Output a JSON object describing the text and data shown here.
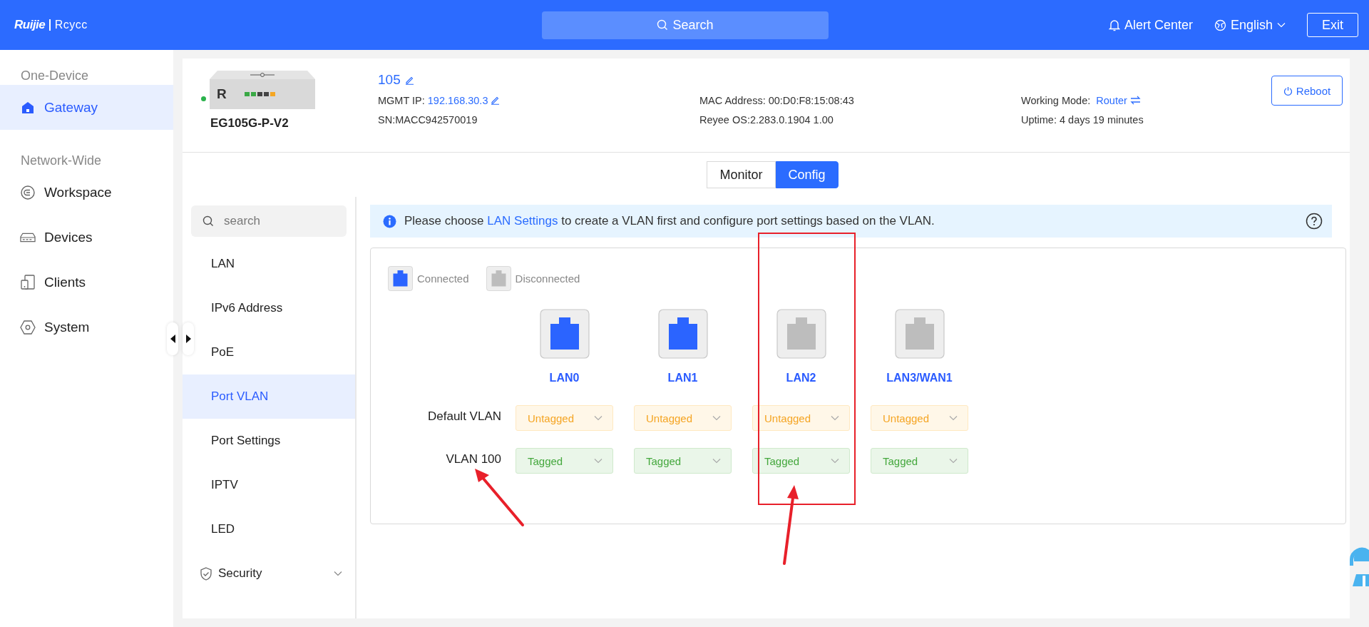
{
  "topbar": {
    "logo_brand": "Ruijie",
    "logo_product": "Rcycc",
    "search": "Search",
    "alert_center": "Alert Center",
    "language": "English",
    "exit": "Exit"
  },
  "sidebar": {
    "sections": [
      {
        "title": "One-Device",
        "items": [
          {
            "label": "Gateway",
            "selected": true
          }
        ]
      },
      {
        "title": "Network-Wide",
        "items": [
          {
            "label": "Workspace",
            "selected": false
          },
          {
            "label": "Devices",
            "selected": false
          },
          {
            "label": "Clients",
            "selected": false
          },
          {
            "label": "System",
            "selected": false
          }
        ]
      }
    ]
  },
  "device": {
    "online": true,
    "image_label": "R",
    "model": "EG105G-P-V2",
    "alias": "105",
    "mgmt_ip_label": "MGMT IP:",
    "mgmt_ip": "192.168.30.3",
    "sn": "SN:MACC942570019",
    "mac": "MAC Address: 00:D0:F8:15:08:43",
    "os": "Reyee OS:2.283.0.1904 1.00",
    "working_mode_label": "Working Mode:",
    "working_mode": "Router",
    "uptime": "Uptime: 4 days 19 minutes",
    "reboot": "Reboot"
  },
  "mode_tabs": [
    {
      "label": "Monitor",
      "selected": false
    },
    {
      "label": "Config",
      "selected": true
    }
  ],
  "config_menu": {
    "placeholder": "search",
    "items": [
      {
        "label": "LAN",
        "selected": false,
        "kind": "item"
      },
      {
        "label": "IPv6 Address",
        "selected": false,
        "kind": "item"
      },
      {
        "label": "PoE",
        "selected": false,
        "kind": "item"
      },
      {
        "label": "Port VLAN",
        "selected": true,
        "kind": "item"
      },
      {
        "label": "Port Settings",
        "selected": false,
        "kind": "item"
      },
      {
        "label": "IPTV",
        "selected": false,
        "kind": "item"
      },
      {
        "label": "LED",
        "selected": false,
        "kind": "item"
      },
      {
        "label": "Security",
        "selected": false,
        "kind": "group",
        "expanded": false
      }
    ]
  },
  "notice": {
    "before": "Please choose ",
    "link": "LAN Settings",
    "after": " to create a VLAN first and configure port settings based on the VLAN."
  },
  "legend": [
    {
      "label": "Connected",
      "connected": true
    },
    {
      "label": "Disconnected",
      "connected": false
    }
  ],
  "ports": [
    {
      "name": "LAN0",
      "connected": true
    },
    {
      "name": "LAN1",
      "connected": true
    },
    {
      "name": "LAN2",
      "connected": false
    },
    {
      "name": "LAN3/WAN1",
      "connected": false
    }
  ],
  "vlans": [
    {
      "name": "Default VLAN",
      "modes": [
        {
          "label": "Untagged",
          "kind": "untagged"
        },
        {
          "label": "Untagged",
          "kind": "untagged"
        },
        {
          "label": "Untagged",
          "kind": "untagged"
        },
        {
          "label": "Untagged",
          "kind": "untagged"
        }
      ]
    },
    {
      "name": "VLAN 100",
      "modes": [
        {
          "label": "Tagged",
          "kind": "tagged"
        },
        {
          "label": "Tagged",
          "kind": "tagged"
        },
        {
          "label": "Tagged",
          "kind": "tagged"
        },
        {
          "label": "Tagged",
          "kind": "tagged"
        }
      ]
    }
  ]
}
